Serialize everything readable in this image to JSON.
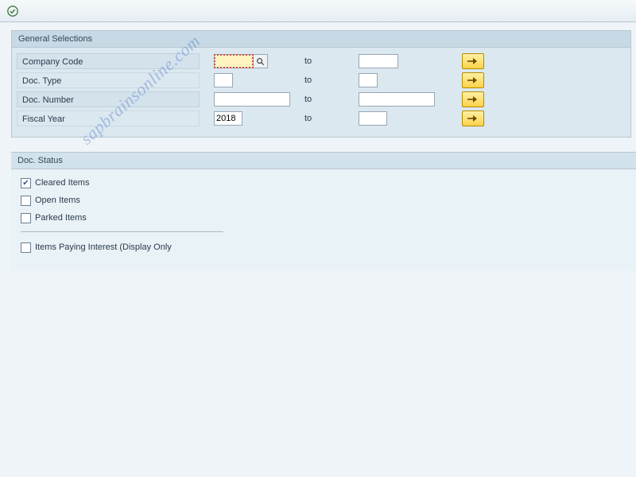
{
  "watermark": "sapbrainsonline.com",
  "general_selections": {
    "title": "General Selections",
    "rows": [
      {
        "label": "Company Code",
        "from": "",
        "to_label": "to",
        "to": "",
        "focus": true,
        "has_f4": true,
        "from_width": 50,
        "to_width": 50
      },
      {
        "label": "Doc. Type",
        "from": "",
        "to_label": "to",
        "to": "",
        "focus": false,
        "has_f4": false,
        "from_width": 24,
        "to_width": 24
      },
      {
        "label": "Doc. Number",
        "from": "",
        "to_label": "to",
        "to": "",
        "focus": false,
        "has_f4": false,
        "from_width": 96,
        "to_width": 96
      },
      {
        "label": "Fiscal Year",
        "from": "2018",
        "to_label": "to",
        "to": "",
        "focus": false,
        "has_f4": false,
        "from_width": 36,
        "to_width": 36
      }
    ]
  },
  "doc_status": {
    "title": "Doc. Status",
    "checks": [
      {
        "label": "Cleared Items",
        "checked": true
      },
      {
        "label": "Open Items",
        "checked": false
      },
      {
        "label": "Parked Items",
        "checked": false
      }
    ],
    "extra_check": {
      "label": "Items Paying Interest (Display Only",
      "checked": false
    }
  }
}
